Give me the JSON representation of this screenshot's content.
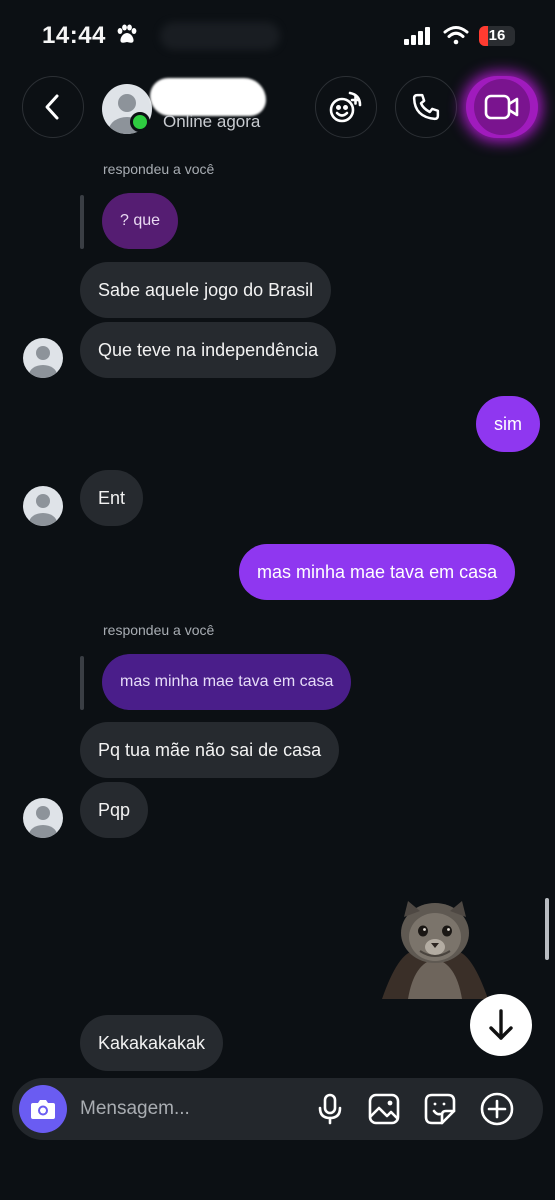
{
  "status_bar": {
    "time": "14:44",
    "battery": "16",
    "battery_color": "#ff3b30"
  },
  "header": {
    "status": "Online agora"
  },
  "messages": [
    {
      "id": "reply1_label",
      "text": "respondeu a você"
    },
    {
      "id": "quoted1",
      "text": "? que"
    },
    {
      "id": "m1",
      "text": "Sabe aquele jogo do Brasil"
    },
    {
      "id": "m2",
      "text": "Que teve na independência"
    },
    {
      "id": "m3",
      "text": "sim"
    },
    {
      "id": "m4",
      "text": "Ent"
    },
    {
      "id": "m5",
      "text": "mas minha mae tava em casa"
    },
    {
      "id": "reply2_label",
      "text": "respondeu a você"
    },
    {
      "id": "quoted2",
      "text": "mas minha mae tava em casa"
    },
    {
      "id": "m6",
      "text": "Pq tua mãe não sai de casa"
    },
    {
      "id": "m7",
      "text": "Pqp"
    },
    {
      "id": "m8",
      "text": "Kakakakakak"
    }
  ],
  "composer": {
    "placeholder": "Mensagem..."
  },
  "colors": {
    "background": "#0c1014",
    "incoming_bubble": "#262a2f",
    "outgoing_bubble": "#8f37f0",
    "video_accent": "#a01bbd",
    "online": "#2ecc40"
  },
  "icons": [
    "paw-icon",
    "signal-icon",
    "wifi-icon",
    "back-arrow-icon",
    "emoji-effects-icon",
    "phone-icon",
    "video-camera-icon",
    "arrow-down-icon",
    "camera-icon",
    "microphone-icon",
    "gallery-icon",
    "sticker-icon",
    "plus-icon"
  ]
}
